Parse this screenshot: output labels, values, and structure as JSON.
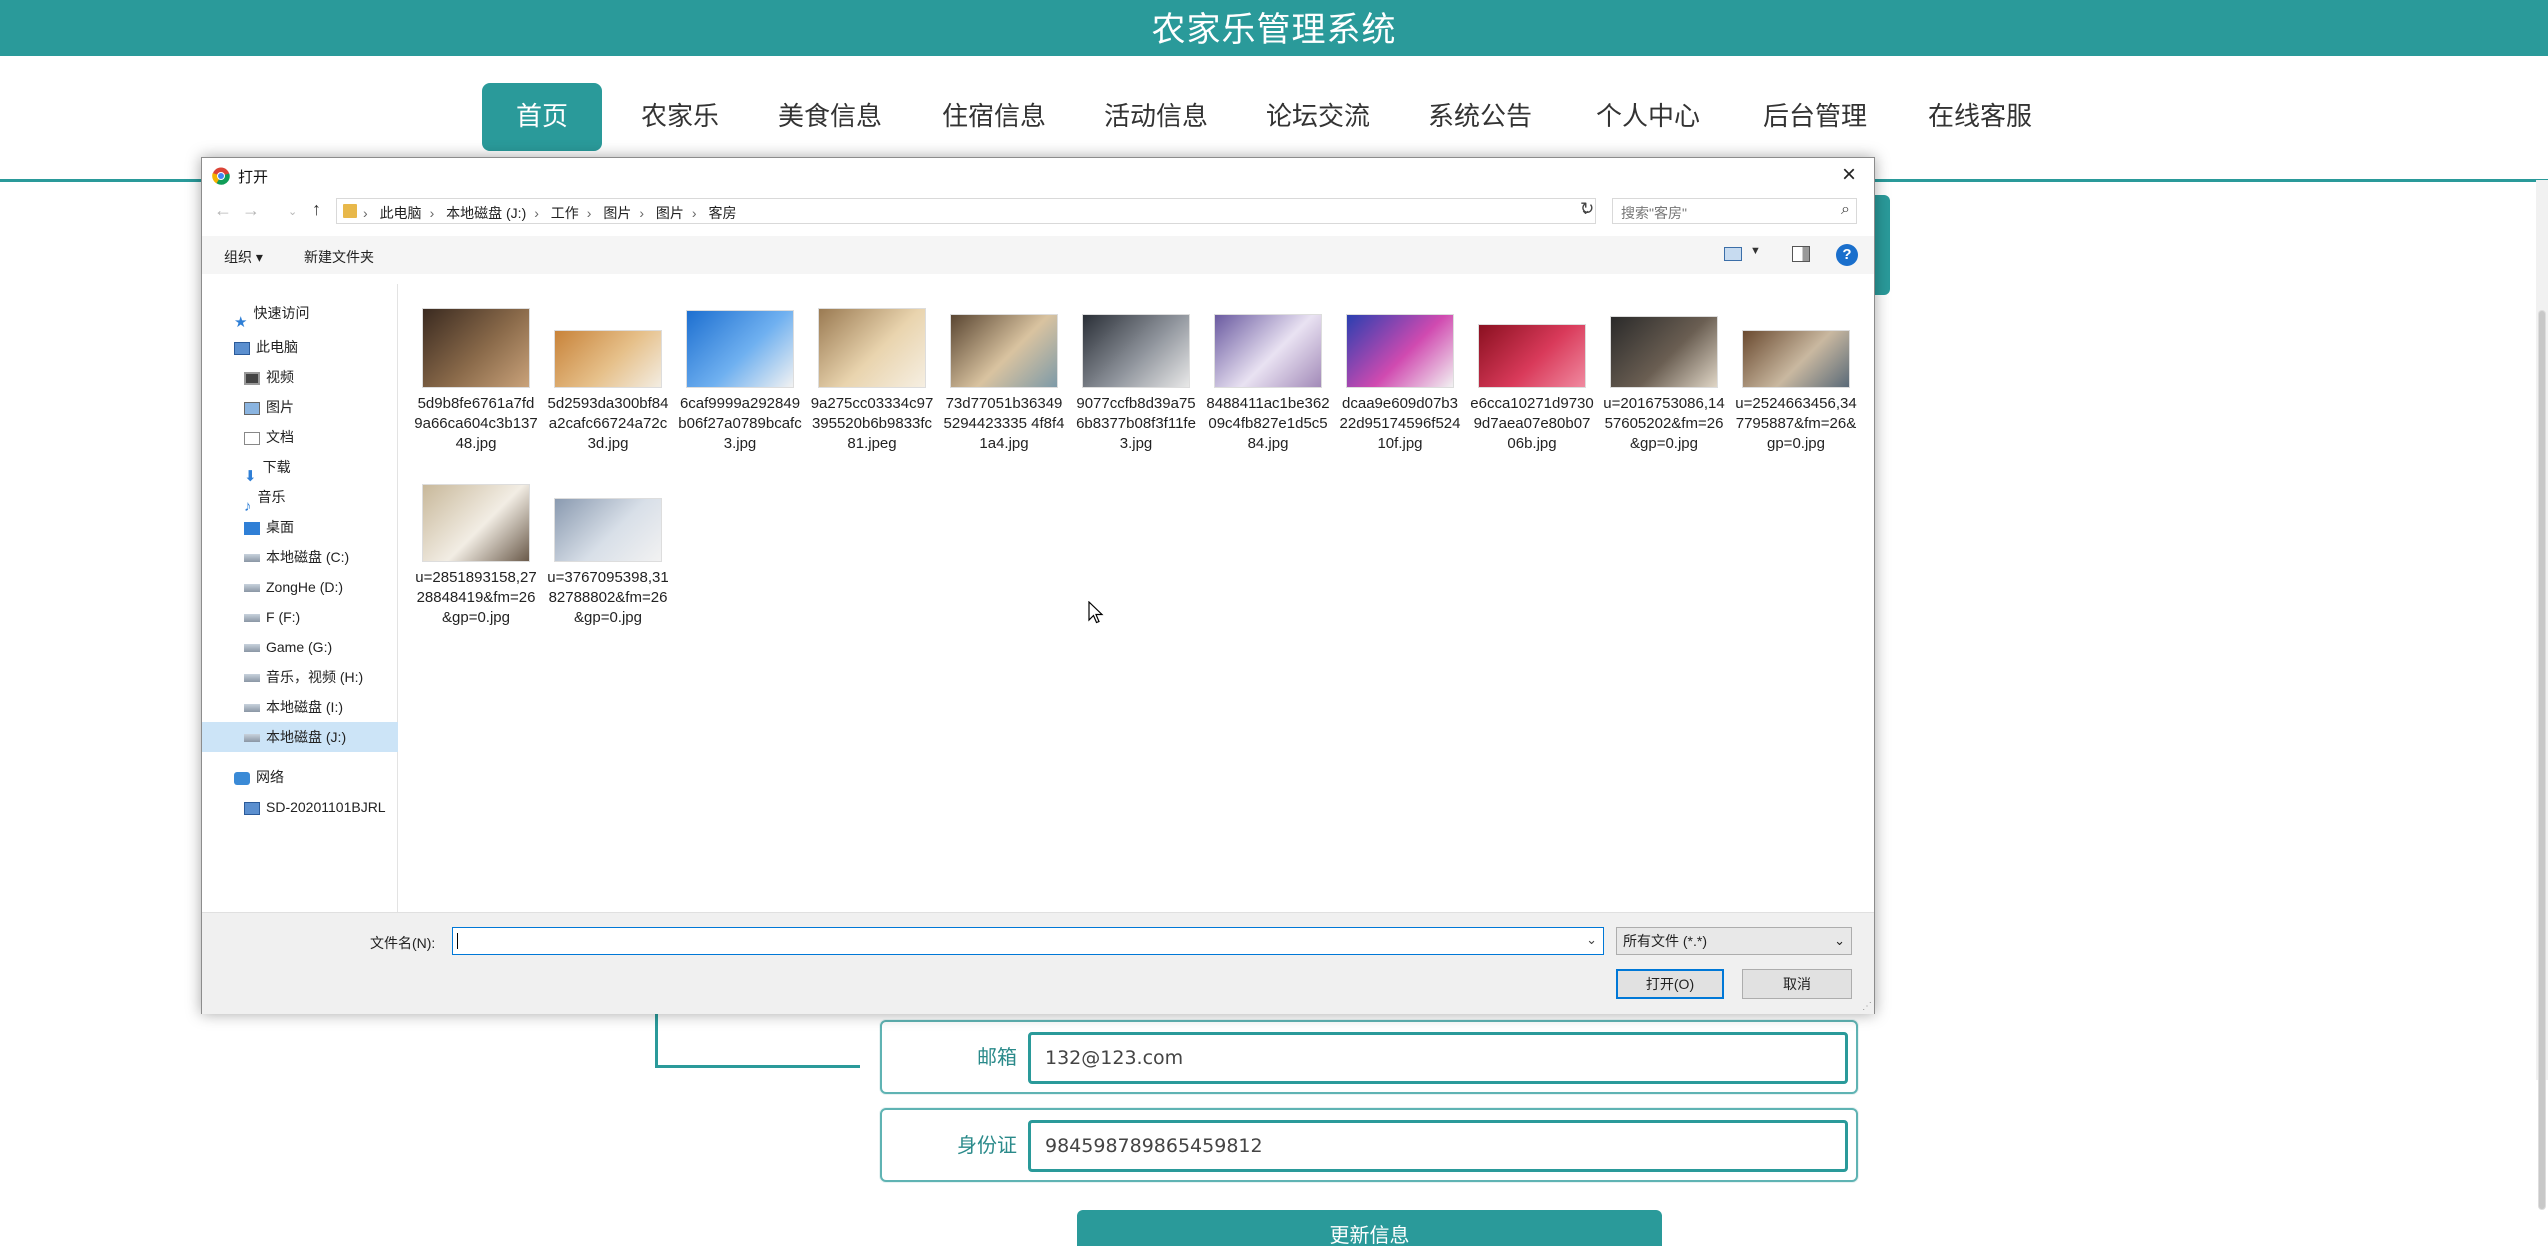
{
  "site": {
    "title": "农家乐管理系统",
    "nav": [
      "首页",
      "农家乐",
      "美食信息",
      "住宿信息",
      "活动信息",
      "论坛交流",
      "系统公告",
      "个人中心",
      "后台管理",
      "在线客服"
    ],
    "active_nav": "首页"
  },
  "form": {
    "email_label": "邮箱",
    "email_value": "132@123.com",
    "id_label": "身份证",
    "id_value": "984598789865459812",
    "update_button": "更新信息"
  },
  "dialog": {
    "title": "打开",
    "path": [
      "此电脑",
      "本地磁盘 (J:)",
      "工作",
      "图片",
      "图片",
      "客房"
    ],
    "search_placeholder": "搜索\"客房\"",
    "toolbar": {
      "organize": "组织 ▾",
      "new_folder": "新建文件夹"
    },
    "nav_pane": [
      {
        "label": "快速访问",
        "icon": "star-icon"
      },
      {
        "label": "此电脑",
        "icon": "computer-icon"
      },
      {
        "label": "视频",
        "icon": "video-folder-icon"
      },
      {
        "label": "图片",
        "icon": "pictures-folder-icon"
      },
      {
        "label": "文档",
        "icon": "documents-folder-icon"
      },
      {
        "label": "下载",
        "icon": "download-icon"
      },
      {
        "label": "音乐",
        "icon": "music-icon"
      },
      {
        "label": "桌面",
        "icon": "desktop-icon"
      },
      {
        "label": "本地磁盘 (C:)",
        "icon": "drive-icon"
      },
      {
        "label": "ZongHe (D:)",
        "icon": "drive-icon"
      },
      {
        "label": "F (F:)",
        "icon": "drive-icon"
      },
      {
        "label": "Game (G:)",
        "icon": "drive-icon"
      },
      {
        "label": "音乐，视频 (H:)",
        "icon": "drive-icon"
      },
      {
        "label": "本地磁盘 (I:)",
        "icon": "drive-icon"
      },
      {
        "label": "本地磁盘 (J:)",
        "icon": "drive-icon",
        "selected": true
      },
      {
        "label": "网络",
        "icon": "network-icon"
      },
      {
        "label": "SD-20201101BJRL",
        "icon": "network-computer-icon"
      }
    ],
    "files": [
      {
        "name": "5d9b8fe6761a7fd9a66ca604c3b13748.jpg",
        "colors": [
          "#3a2a20",
          "#8a6a4a",
          "#c9a27a"
        ]
      },
      {
        "name": "5d2593da300bf84a2cafc66724a72c3d.jpg",
        "colors": [
          "#c8833a",
          "#e6c08a",
          "#f3ede2"
        ]
      },
      {
        "name": "6caf9999a292849b06f27a0789bcafc3.jpg",
        "colors": [
          "#1d6fd0",
          "#6fb0f0",
          "#f2f2f2"
        ]
      },
      {
        "name": "9a275cc03334c97395520b6b9833fc81.jpeg",
        "colors": [
          "#9a7a52",
          "#e9d4ae",
          "#f6efe2"
        ]
      },
      {
        "name": "73d77051b363495294423335 4f8f41a4.jpg",
        "colors": [
          "#5a4632",
          "#d9c3a0",
          "#7d9aa8"
        ]
      },
      {
        "name": "9077ccfb8d39a756b8377b08f3f11fe3.jpg",
        "colors": [
          "#2a2f37",
          "#8f949c",
          "#e8e8e8"
        ]
      },
      {
        "name": "8488411ac1be36209c4fb827e1d5c584.jpg",
        "colors": [
          "#6a5aa0",
          "#e9e2f2",
          "#a28ab8"
        ]
      },
      {
        "name": "dcaa9e609d07b322d95174596f52410f.jpg",
        "colors": [
          "#2a3fb0",
          "#d04ab0",
          "#f2f2f2"
        ]
      },
      {
        "name": "e6cca10271d97309d7aea07e80b0706b.jpg",
        "colors": [
          "#8a1020",
          "#d93a5a",
          "#f08aa0"
        ]
      },
      {
        "name": "u=2016753086,1457605202&fm=26&gp=0.jpg",
        "colors": [
          "#2a2a2a",
          "#6a5e52",
          "#e0d6c6"
        ]
      },
      {
        "name": "u=2524663456,347795887&fm=26&gp=0.jpg",
        "colors": [
          "#6a4a30",
          "#c9b8a0",
          "#5a6a78"
        ]
      },
      {
        "name": "u=2851893158,2728848419&fm=26&gp=0.jpg",
        "colors": [
          "#c8b89a",
          "#f2ede4",
          "#6a5a4a"
        ]
      },
      {
        "name": "u=3767095398,3182788802&fm=26&gp=0.jpg",
        "colors": [
          "#8a9ab0",
          "#d8dfe8",
          "#f2f2f2"
        ]
      }
    ],
    "filename_label": "文件名(N):",
    "filename_value": "",
    "filetype": "所有文件 (*.*)",
    "open_button": "打开(O)",
    "cancel_button": "取消"
  },
  "colors": {
    "brand": "#2a9a9a",
    "selection": "#cce4f7",
    "focus": "#0078d7"
  }
}
